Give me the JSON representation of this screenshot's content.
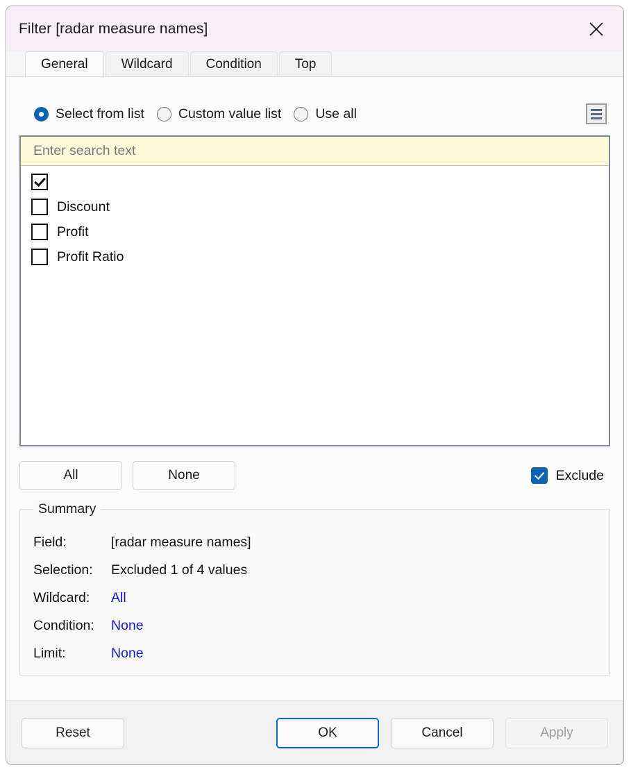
{
  "dialog": {
    "title": "Filter [radar measure names]",
    "close_icon": "close-icon"
  },
  "tabs": [
    {
      "label": "General",
      "active": true
    },
    {
      "label": "Wildcard",
      "active": false
    },
    {
      "label": "Condition",
      "active": false
    },
    {
      "label": "Top",
      "active": false
    }
  ],
  "mode": {
    "options": [
      {
        "label": "Select from list",
        "selected": true
      },
      {
        "label": "Custom value list",
        "selected": false
      },
      {
        "label": "Use all",
        "selected": false
      }
    ],
    "list_menu_icon": "hamburger-menu-icon"
  },
  "search": {
    "value": "",
    "placeholder": "Enter search text"
  },
  "values": [
    {
      "label": "",
      "checked": true
    },
    {
      "label": "Discount",
      "checked": false
    },
    {
      "label": "Profit",
      "checked": false
    },
    {
      "label": "Profit Ratio",
      "checked": false
    }
  ],
  "actions": {
    "all_label": "All",
    "none_label": "None",
    "exclude_label": "Exclude",
    "exclude_checked": true
  },
  "summary": {
    "legend": "Summary",
    "rows": [
      {
        "key": "Field:",
        "value": "[radar measure names]",
        "link": false
      },
      {
        "key": "Selection:",
        "value": "Excluded 1 of 4 values",
        "link": false
      },
      {
        "key": "Wildcard:",
        "value": "All",
        "link": true
      },
      {
        "key": "Condition:",
        "value": "None",
        "link": true
      },
      {
        "key": "Limit:",
        "value": "None",
        "link": true
      }
    ]
  },
  "footer": {
    "reset_label": "Reset",
    "ok_label": "OK",
    "cancel_label": "Cancel",
    "apply_label": "Apply",
    "apply_disabled": true
  },
  "colors": {
    "titlebar_bg": "#f6eff6",
    "accent_blue": "#0a64b4",
    "link_blue": "#1414e8",
    "search_bg": "#fbfbdc",
    "listbox_border": "#7e8490"
  }
}
